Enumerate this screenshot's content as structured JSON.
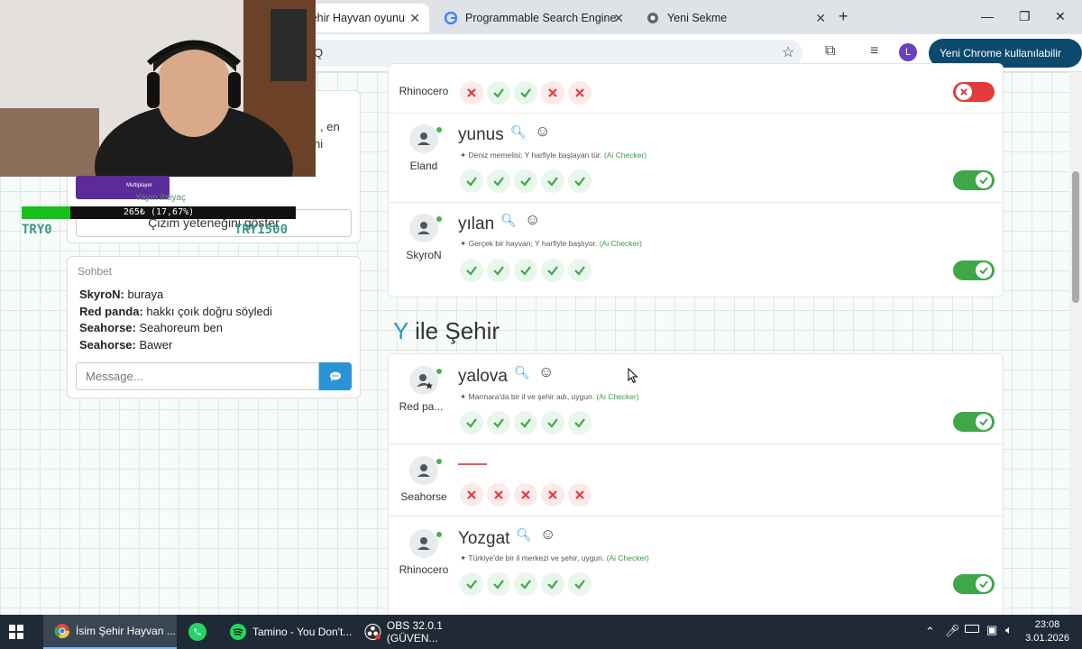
{
  "browser": {
    "tabs": [
      {
        "label": "İsim Şehir Hayvan oyununa katıl",
        "active": true
      },
      {
        "label": "Programmable Search Engine",
        "active": false
      },
      {
        "label": "Yeni Sekme",
        "active": false
      }
    ],
    "omnibox_text": "Q",
    "profile_initial": "L",
    "promo_label": "Yeni Chrome kullanılabilir"
  },
  "left_panel": {
    "partial_text_1": ", en",
    "partial_text_2": "ni",
    "draw_button_label": "Çizim yeteneğini göster",
    "chat": {
      "title": "Sohbet",
      "messages": [
        {
          "user": "SkyroN:",
          "text": "buraya"
        },
        {
          "user": "Red panda:",
          "text": "hakkı çoık doğru söyledi"
        },
        {
          "user": "Seahorse:",
          "text": "Seahoreum ben"
        },
        {
          "user": "Seahorse:",
          "text": "Bawer"
        }
      ],
      "input_placeholder": "Message..."
    }
  },
  "stream_overlay": {
    "donation_badge": "Multiplayer",
    "goal_title": "Yayın ihtiyaç",
    "goal_text": "265₺ (17,67%)",
    "goal_progress": 0.1767,
    "goal_min": "TRY0",
    "goal_max": "TRY1500"
  },
  "animals": {
    "rows": [
      {
        "player": "Rhinocero",
        "word": "",
        "ai_note": "",
        "votes": [
          "x",
          "check",
          "check",
          "x",
          "x"
        ],
        "accepted": false
      },
      {
        "player": "Eland",
        "word": "yunus",
        "ai_note": "Deniz memelisi; Y harfiyle başlayan tür.",
        "ai_tag": "(Ai Checker)",
        "votes": [
          "check",
          "check",
          "check",
          "check",
          "check"
        ],
        "accepted": true
      },
      {
        "player": "SkyroN",
        "word": "yılan",
        "ai_note": "Gerçek bir hayvan; Y harfiyle başlıyor.",
        "ai_tag": "(Ai Checker)",
        "votes": [
          "check",
          "check",
          "check",
          "check",
          "check"
        ],
        "accepted": true
      }
    ]
  },
  "cities": {
    "section_letter": "Y",
    "section_title": "ile Şehir",
    "rows": [
      {
        "player": "Red pa...",
        "word": "yalova",
        "ai_note": "Marmara'da bir il ve şehir adı, uygun.",
        "ai_tag": "(Ai Checker)",
        "votes": [
          "check",
          "check",
          "check",
          "check",
          "check"
        ],
        "accepted": true
      },
      {
        "player": "Seahorse",
        "word": "",
        "ai_note": "",
        "votes": [
          "x",
          "x",
          "x",
          "x",
          "x"
        ],
        "accepted": null
      },
      {
        "player": "Rhinocero",
        "word": "Yozgat",
        "ai_note": "Türkiye'de bir il merkezi ve şehir, uygun.",
        "ai_tag": "(Ai Checker)",
        "votes": [
          "check",
          "check",
          "check",
          "check",
          "check"
        ],
        "accepted": true
      }
    ]
  },
  "taskbar": {
    "items": [
      {
        "label": "İsim Şehir Hayvan ..."
      },
      {
        "label": "Tamino - You Don't..."
      },
      {
        "label": "OBS 32.0.1 (GÜVEN..."
      }
    ],
    "time": "23:08",
    "date": "3.01.2026"
  },
  "colors": {
    "accent": "#2a93d5",
    "ok": "#3fa64a",
    "error": "#e33b3b"
  }
}
